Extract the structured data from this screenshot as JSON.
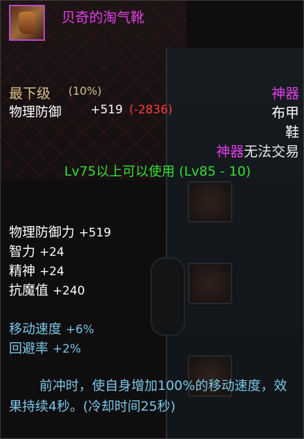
{
  "item": {
    "name": "贝奇的淘气靴",
    "grade_label": "最下级",
    "grade_pct": "(10%)",
    "rarity": "神器",
    "armor_type": "布甲",
    "slot_type": "鞋",
    "phys_def_label": "物理防御",
    "phys_def_value": "+519",
    "phys_def_diff": "(-2836)",
    "trade_rarity": "神器",
    "trade_text": "无法交易",
    "level_req": "Lv75以上可以使用 (Lv85 - 10)"
  },
  "stats": [
    {
      "label": "物理防御力",
      "value": "+519"
    },
    {
      "label": "智力",
      "value": "+24"
    },
    {
      "label": "精神",
      "value": "+24"
    },
    {
      "label": "抗魔值",
      "value": "+240"
    }
  ],
  "buffs": [
    {
      "label": "移动速度",
      "value": "+6%"
    },
    {
      "label": "回避率",
      "value": "+2%"
    }
  ],
  "description": "前冲时，使自身增加100%的移动速度，效果持续4秒。(冷却时间25秒)",
  "colors": {
    "rarity": "#e040e8",
    "level": "#33e033",
    "buff": "#7ac8e8",
    "debuff": "#ff3c3c",
    "grade": "#d8c28a"
  },
  "icons": {
    "item": "boot-icon"
  }
}
